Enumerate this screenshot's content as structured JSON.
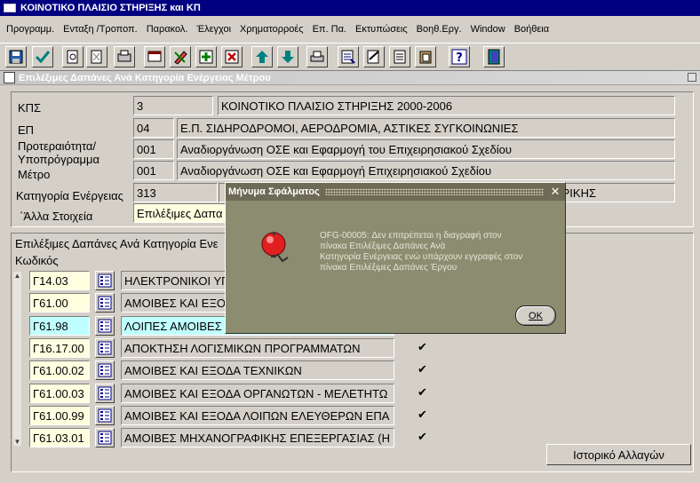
{
  "window": {
    "title": "ΚΟΙΝΟΤΙΚΟ ΠΛΑΙΣΙΟ ΣΤΗΡΙΞΗΣ και ΚΠ"
  },
  "menu": [
    "Προγραμμ.",
    "Ενταξη /Τροποπ.",
    "Παρακολ.",
    "Έλεγχοι",
    "Χρηματορροές",
    "Επ. Πα.",
    "Εκτυπώσεις",
    "Βοηθ.Εργ.",
    "Window",
    "Βοήθεια"
  ],
  "toolbar_icons": [
    "save-icon",
    "accept-icon",
    "query-icon",
    "clear-icon",
    "print-form-icon",
    "enter-query-icon",
    "edit-icon",
    "insert-record-icon",
    "delete-record-icon",
    "previous-record-icon",
    "next-record-icon",
    "print-icon",
    "list-icon",
    "notes-icon",
    "document-icon",
    "paste-icon",
    "help-icon",
    "exit-icon"
  ],
  "form": {
    "title": "Επιλέξιμες Δαπάνες Ανά Κατηγορία Ενέργειας Μέτρου",
    "kps": {
      "label": "ΚΠΣ",
      "code": "3",
      "value": "ΚΟΙΝΟΤΙΚΟ ΠΛΑΙΣΙΟ ΣΤΗΡΙΞΗΣ 2000-2006"
    },
    "ep": {
      "label": "ΕΠ",
      "code": "04",
      "value": "Ε.Π. ΣΙΔΗΡΟΔΡΟΜΟΙ, ΑΕΡΟΔΡΟΜΙΑ, ΑΣΤΙΚΕΣ ΣΥΓΚΟΙΝΩΝΙΕΣ"
    },
    "priority": {
      "label1": "Προτεραιότητα/",
      "label2": "Υποπρόγραμμα",
      "code": "001",
      "value": "Αναδιοργάνωση ΟΣΕ και Εφαρμογή του Επιχειρησιακού Σχεδίου"
    },
    "measure": {
      "label": "Μέτρο",
      "code": "001",
      "value": "Αναδιοργάνωση ΟΣΕ και Εφαρμογή Επιχειρησιακού Σχεδίου"
    },
    "category": {
      "label": "Κατηγορία Ενέργειας",
      "code": "313",
      "value_tail": "ΡΙΚΗΣ"
    },
    "other": {
      "label": "΄Άλλα Στοιχεία",
      "value": "Επιλέξιμες Δαπα"
    }
  },
  "list": {
    "heading": "Επιλέξιμες Δαπάνες Ανά Κατηγορία Ενε",
    "code_header": "Κωδικός",
    "rows": [
      {
        "code": "Γ14.03",
        "desc": "ΗΛΕΚΤΡΟΝΙΚΟΙ ΥΠ",
        "checked": false,
        "highlight": false
      },
      {
        "code": "Γ61.00",
        "desc": "ΑΜΟΙΒΕΣ ΚΑΙ ΕΞΟ",
        "checked": false,
        "highlight": false
      },
      {
        "code": "Γ61.98",
        "desc": "ΛΟΙΠΕΣ ΑΜΟΙΒΕΣ",
        "checked": false,
        "highlight": true
      },
      {
        "code": "Γ16.17.00",
        "desc": "ΑΠΟΚΤΗΣΗ ΛΟΓΙΣΜΙΚΩΝ ΠΡΟΓΡΑΜΜΑΤΩΝ",
        "checked": true,
        "highlight": false
      },
      {
        "code": "Γ61.00.02",
        "desc": "ΑΜΟΙΒΕΣ ΚΑΙ ΕΞΟΔΑ  ΤΕΧΝΙΚΩΝ",
        "checked": true,
        "highlight": false
      },
      {
        "code": "Γ61.00.03",
        "desc": "ΑΜΟΙΒΕΣ ΚΑΙ ΕΞΟΔΑ ΟΡΓΑΝΩΤΩΝ - ΜΕΛΕΤΗΤΩ",
        "checked": true,
        "highlight": false
      },
      {
        "code": "Γ61.00.99",
        "desc": "ΑΜΟΙΒΕΣ ΚΑΙ ΕΞΟΔΑ ΛΟΙΠΩΝ ΕΛΕΥΘΕΡΩΝ ΕΠΑ",
        "checked": true,
        "highlight": false
      },
      {
        "code": "Γ61.03.01",
        "desc": "ΑΜΟΙΒΕΣ ΜΗΧΑΝΟΓΡΑΦΙΚΗΣ ΕΠΕΞΕΡΓΑΣΙΑΣ (Η",
        "checked": true,
        "highlight": false
      }
    ],
    "history_button": "Ιστορικό Αλλαγών"
  },
  "dialog": {
    "title": "Μήνυμα Σφάλματος",
    "message_lines": [
      "OFG-00005: Δεν επιτρέπεται η διαγραφή στον",
      "πίνακα Επιλέξιμες Δαπάνες Ανά",
      "Κατηγορία Ενέργειας ενώ υπάρχουν εγγραφές στον",
      "πίνακα Επιλέξιμες Δαπάνες Έργου"
    ],
    "ok": "OK",
    "icon": "alarm-bell-icon"
  },
  "check_glyph": "✔",
  "colors": {
    "titlebar": "#000080",
    "dialog_bg": "#8c8c70",
    "highlight": "#c0ffff",
    "field_yellow": "#ffffe0"
  }
}
